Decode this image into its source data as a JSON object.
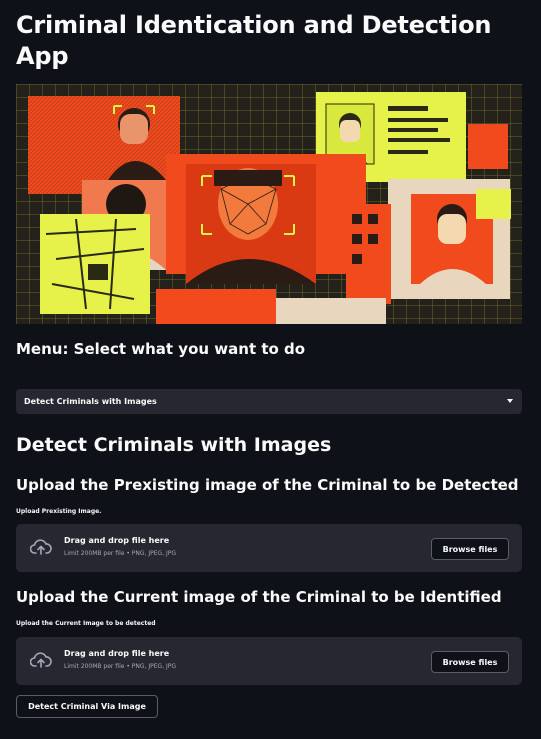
{
  "app": {
    "title": "Criminal Identication and Detection App"
  },
  "menu": {
    "label": "Menu: Select what you want to do",
    "selected": "Detect Criminals with Images"
  },
  "section": {
    "heading": "Detect Criminals with Images"
  },
  "uploaders": [
    {
      "heading": "Upload the Prexisting image of the Criminal to be Detected",
      "label": "Upload Prexisting Image.",
      "drop_text": "Drag and drop file here",
      "limit_text": "Limit 200MB per file • PNG, JPEG, JPG",
      "button": "Browse files"
    },
    {
      "heading": "Upload the Current image of the Criminal to be Identified",
      "label": "Upload the Current Image to be detected",
      "drop_text": "Drag and drop file here",
      "limit_text": "Limit 200MB per file • PNG, JPEG, JPG",
      "button": "Browse files"
    }
  ],
  "actions": {
    "detect_button": "Detect Criminal Via Image"
  },
  "icons": {
    "upload": "cloud-upload-icon",
    "dropdown": "chevron-down-icon"
  },
  "colors": {
    "background": "#0e1117",
    "widget": "#262730",
    "hero_orange": "#f04a1d",
    "hero_yellow": "#e6f24a"
  }
}
